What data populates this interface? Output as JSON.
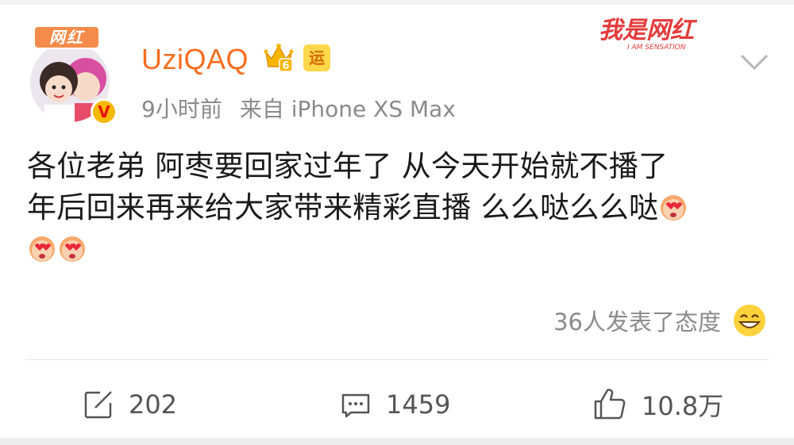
{
  "post": {
    "avatar_badge": "网红",
    "verified_mark": "V",
    "username": "UziQAQ",
    "crown_level": "6",
    "yun_badge": "运",
    "time": "9小时前",
    "source": "来自 iPhone XS Max",
    "watermark": {
      "main": "我是网红",
      "sub": "I AM SENSATION"
    },
    "content_line1": "各位老弟 阿枣要回家过年了 从今天开始就不播了",
    "content_line2": "年后回来再来给大家带来精彩直播 么么哒么么哒",
    "reactions_text": "36人发表了态度"
  },
  "actions": {
    "repost_count": "202",
    "comment_count": "1459",
    "like_count": "10.8万"
  },
  "colors": {
    "username": "#f86d1e",
    "meta": "#8a8a8a",
    "text": "#1a1a1a",
    "watermark": "#e43b3b"
  },
  "icons": [
    "crown-icon",
    "chevron-down-icon",
    "heart-eyes-emoji",
    "smile-emoji",
    "repost-icon",
    "comment-icon",
    "like-icon"
  ]
}
